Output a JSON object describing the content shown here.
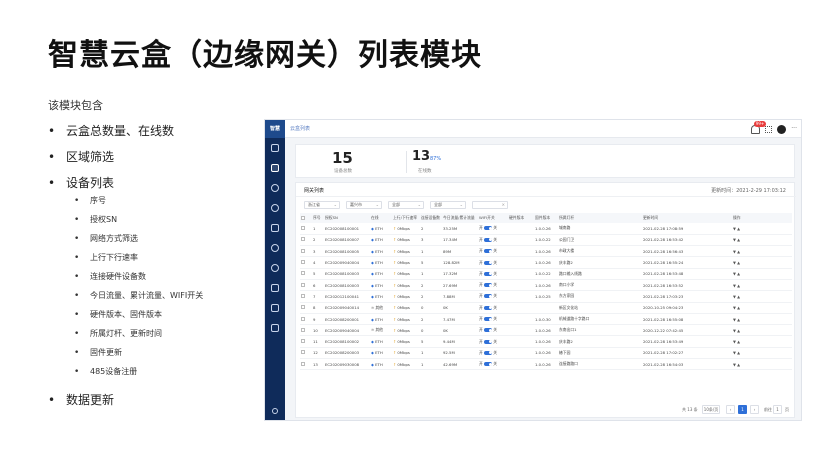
{
  "slide": {
    "title": "智慧云盒（边缘网关）列表模块",
    "intro": "该模块包含",
    "bullets": [
      {
        "text": "云盒总数量、在线数",
        "level": 1
      },
      {
        "text": "区域筛选",
        "level": 1
      },
      {
        "text": "设备列表",
        "level": 1
      },
      {
        "text": "序号",
        "level": 2
      },
      {
        "text": "授权SN",
        "level": 2
      },
      {
        "text": "网络方式筛选",
        "level": 2
      },
      {
        "text": "上行下行速率",
        "level": 2
      },
      {
        "text": "连接硬件设备数",
        "level": 2
      },
      {
        "text": "今日流量、累计流量、WIFI开关",
        "level": 2
      },
      {
        "text": "硬件版本、固件版本",
        "level": 2
      },
      {
        "text": "所属灯杆、更新时间",
        "level": 2
      },
      {
        "text": "固件更新",
        "level": 2
      },
      {
        "text": "485设备注册",
        "level": 2
      },
      {
        "text": "数据更新",
        "level": 1
      }
    ]
  },
  "app": {
    "brand": "智慧",
    "breadcrumb": "云盒列表",
    "notify_count": "99+",
    "summary": {
      "total": "15",
      "total_label": "设备总数",
      "online": "13",
      "online_pct": "87%",
      "online_label": "在线数"
    },
    "panel_title": "网关列表",
    "refresh_time": "更新时间：2021-2-29 17:03:12",
    "filters": [
      "浙江省",
      "嘉兴市",
      "全部",
      "全部",
      ""
    ],
    "columns": [
      "",
      "序号",
      "授权SN",
      "在线",
      "上行/下行速率",
      "连接设备数",
      "今日流量/累计流量",
      "WIFI开关",
      "硬件版本",
      "固件版本",
      "所属灯杆",
      "更新时间",
      "操作"
    ],
    "rows": [
      {
        "n": "1",
        "sn": "EC202008100001",
        "net": "ETH",
        "rate": "0Mbps",
        "dev": "2",
        "flow": "33.25M",
        "hw": "1.0.0.26",
        "pole": "城南路",
        "time": "2021-02-28 17:08:59"
      },
      {
        "n": "2",
        "sn": "EC202008100007",
        "net": "ETH",
        "rate": "0Mbps",
        "dev": "3",
        "flow": "17.34M",
        "hw": "1.0.0.22",
        "pole": "公园门卫",
        "time": "2021-02-28 16:53:42"
      },
      {
        "n": "3",
        "sn": "EC202008100005",
        "net": "ETH",
        "rate": "0Mbps",
        "dev": "1",
        "flow": "89M",
        "hw": "1.0.0.26",
        "pole": "市政大楼",
        "time": "2021-02-28 16:56:43"
      },
      {
        "n": "4",
        "sn": "EC202009040004",
        "net": "ETH",
        "rate": "0Mbps",
        "dev": "5",
        "flow": "128.82M",
        "hw": "1.0.0.26",
        "pole": "庆丰路2",
        "time": "2021-02-28 16:55:24"
      },
      {
        "n": "5",
        "sn": "EC202008100003",
        "net": "ETH",
        "rate": "0Mbps",
        "dev": "1",
        "flow": "17.32M",
        "hw": "1.0.0.22",
        "pole": "路口输入线路",
        "time": "2021-02-28 16:53:48"
      },
      {
        "n": "6",
        "sn": "EC202008100003",
        "net": "ETH",
        "rate": "0Mbps",
        "dev": "2",
        "flow": "27.69M",
        "hw": "1.0.0.26",
        "pole": "南口小学",
        "time": "2021-02-28 16:53:52"
      },
      {
        "n": "7",
        "sn": "EC202012100041",
        "net": "ETH",
        "rate": "0Mbps",
        "dev": "2",
        "flow": "7.88M",
        "hw": "1.0.0.25",
        "pole": "东方家园",
        "time": "2021-02-28 17:03:23"
      },
      {
        "n": "8",
        "sn": "EC202009040014",
        "net": "其他",
        "rate": "0Mbps",
        "dev": "0",
        "flow": "0K",
        "hw": "",
        "pole": "新区文化站",
        "time": "2020-10-25 09:04:23"
      },
      {
        "n": "9",
        "sn": "EC202008200001",
        "net": "ETH",
        "rate": "0Mbps",
        "dev": "2",
        "flow": "7.47M",
        "hw": "1.0.0.30",
        "pole": "机械道路十字路口",
        "time": "2021-02-28 16:55:08"
      },
      {
        "n": "10",
        "sn": "EC202009040004",
        "net": "其他",
        "rate": "0Mbps",
        "dev": "0",
        "flow": "0K",
        "hw": "1.0.0.26",
        "pole": "东南出口1",
        "time": "2020-12-22 07:42:45"
      },
      {
        "n": "11",
        "sn": "EC202008100002",
        "net": "ETH",
        "rate": "0Mbps",
        "dev": "5",
        "flow": "9.44M",
        "hw": "1.0.0.26",
        "pole": "庆丰路2",
        "time": "2021-02-28 16:53:49"
      },
      {
        "n": "12",
        "sn": "EC202008200003",
        "net": "ETH",
        "rate": "0Mbps",
        "dev": "1",
        "flow": "92.5M",
        "hw": "1.0.0.26",
        "pole": "椿下园",
        "time": "2021-02-28 17:02:27"
      },
      {
        "n": "13",
        "sn": "EC202009030008",
        "net": "ETH",
        "rate": "0Mbps",
        "dev": "1",
        "flow": "42.69M",
        "hw": "1.0.0.26",
        "pole": "连接路路口",
        "time": "2021-02-28 16:54:03"
      }
    ],
    "wifi_on": "开",
    "wifi_off": "关",
    "op_icons": [
      "▼",
      "▲"
    ],
    "pager": {
      "total": "共 13 条",
      "size": "10条/页",
      "page": "1",
      "goto_label": "前往",
      "goto_page": "1",
      "goto_suffix": "页"
    }
  }
}
